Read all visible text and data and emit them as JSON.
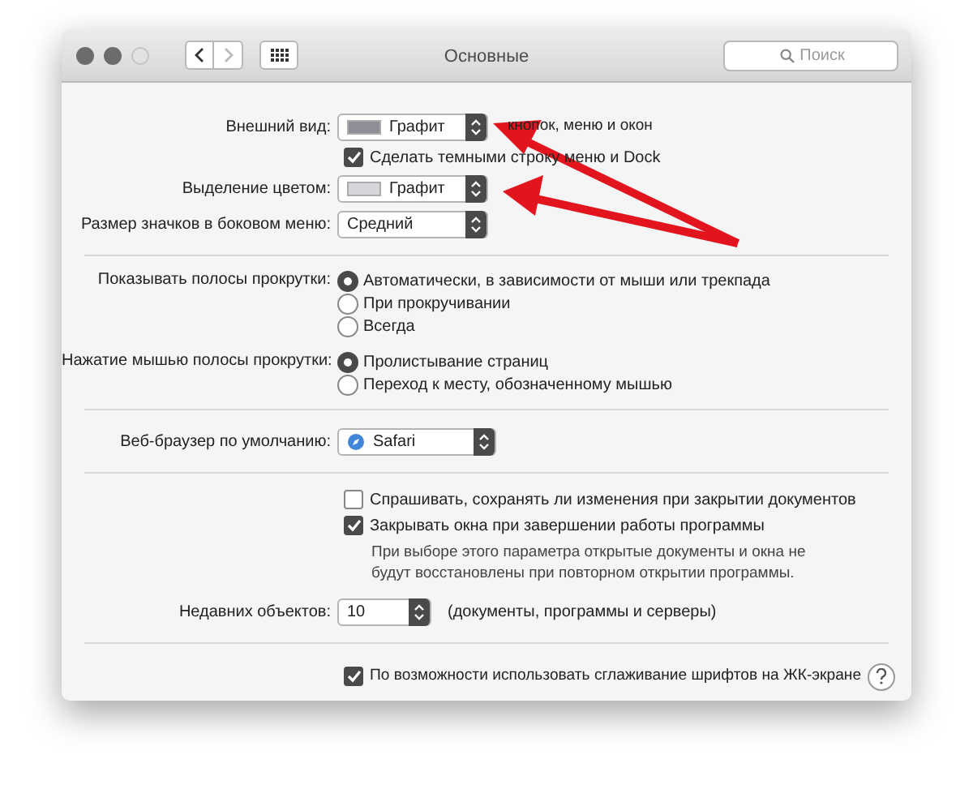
{
  "window": {
    "title": "Основные",
    "search": {
      "placeholder": "Поиск"
    },
    "nav": {
      "back_disabled": false,
      "forward_disabled": true
    }
  },
  "settings": [
    {
      "kind": "popup",
      "label": "Внешний вид:",
      "value": "Графит",
      "color": "#8e8e96",
      "suffix": "кнопок, меню и окон"
    },
    {
      "kind": "checkbox",
      "text": "Сделать темными строку меню и Dock",
      "checked": true
    },
    {
      "kind": "popup",
      "label": "Выделение цветом:",
      "value": "Графит",
      "color": "#d6d6da"
    },
    {
      "kind": "popup",
      "label": "Размер значков в боковом меню:",
      "value": "Средний"
    },
    {
      "kind": "separator"
    },
    {
      "kind": "radio_group",
      "label": "Показывать полосы прокрутки:",
      "options": [
        {
          "text": "Автоматически, в зависимости от мыши или трекпада",
          "selected": true
        },
        {
          "text": "При прокручивании",
          "selected": false
        },
        {
          "text": "Всегда",
          "selected": false
        }
      ]
    },
    {
      "kind": "radio_group",
      "label": "Нажатие мышью полосы прокрутки:",
      "options": [
        {
          "text": "Пролистывание страниц",
          "selected": true
        },
        {
          "text": "Переход к месту, обозначенному мышью",
          "selected": false
        }
      ]
    },
    {
      "kind": "separator"
    },
    {
      "kind": "app_popup",
      "label": "Веб-браузер по умолчанию:",
      "value": "Safari"
    },
    {
      "kind": "separator"
    },
    {
      "kind": "checkbox",
      "text": "Спрашивать, сохранять ли изменения при закрытии документов",
      "checked": false
    },
    {
      "kind": "checkbox",
      "text": "Закрывать окна при завершении работы программы",
      "checked": true
    },
    {
      "kind": "note",
      "text": "При выборе этого параметра открытые документы и окна не будут восстановлены при повторном открытии программы."
    },
    {
      "kind": "stepper",
      "label": "Недавних объектов:",
      "value": "10",
      "suffix": "(документы, программы и серверы)"
    },
    {
      "kind": "separator"
    },
    {
      "kind": "checkbox",
      "text": "По возможности использовать сглаживание шрифтов на ЖК-экране",
      "checked": true,
      "help": true
    }
  ]
}
